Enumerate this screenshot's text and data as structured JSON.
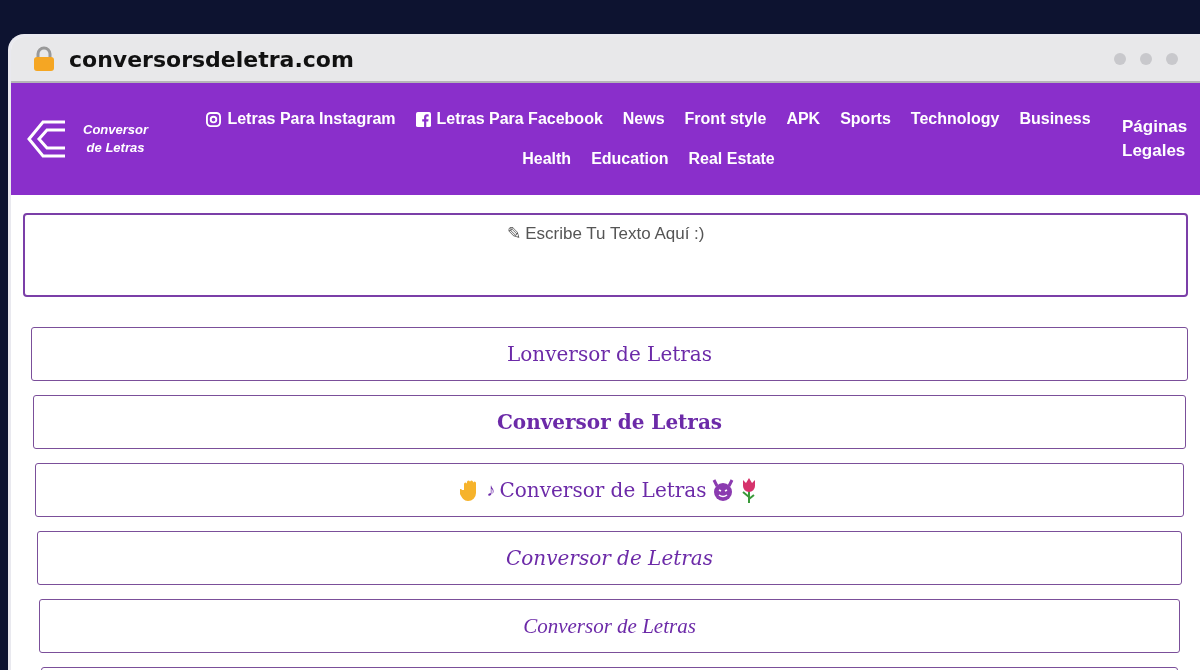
{
  "browser": {
    "url": "conversorsdeletra.com"
  },
  "logo": {
    "line1": "Conversor",
    "line2": "de Letras"
  },
  "nav_top": [
    {
      "label": "Letras Para Instagram",
      "kind": "social"
    },
    {
      "label": "Letras Para Facebook",
      "kind": "social"
    },
    {
      "label": "News",
      "kind": "plain"
    },
    {
      "label": "Front style",
      "kind": "plain"
    },
    {
      "label": "APK",
      "kind": "plain"
    },
    {
      "label": "Sports",
      "kind": "plain"
    },
    {
      "label": "Technology",
      "kind": "plain"
    },
    {
      "label": "Business",
      "kind": "plain"
    }
  ],
  "nav_bottom": [
    {
      "label": "Health"
    },
    {
      "label": "Education"
    },
    {
      "label": "Real Estate"
    }
  ],
  "nav_legal": {
    "label": "Páginas Legales"
  },
  "input": {
    "placeholder": "✎ Escribe Tu Texto Aquí :)"
  },
  "results": [
    {
      "kind": "gothic",
      "text": "Lonversor de Letras"
    },
    {
      "kind": "blackletter",
      "text": "Conversor de Letras"
    },
    {
      "kind": "decorated",
      "prefix": "♪",
      "text": "Conversor de Letras"
    },
    {
      "kind": "script",
      "text": "Conversor de Letras"
    },
    {
      "kind": "fancy",
      "text": "Conversor de Letras"
    },
    {
      "kind": "cut"
    }
  ]
}
